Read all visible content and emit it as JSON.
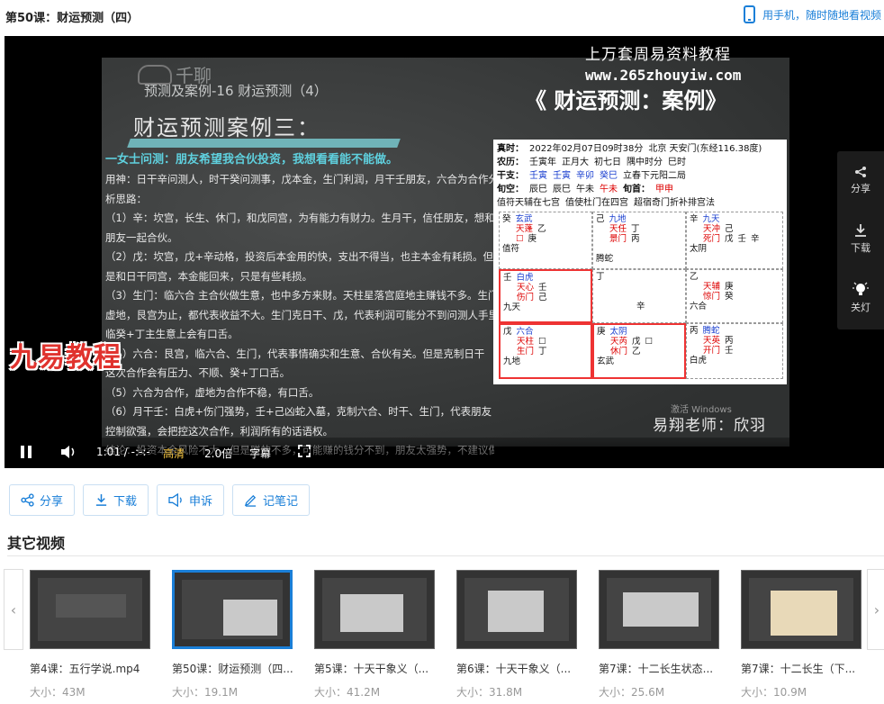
{
  "header": {
    "lesson_title": "第50课：财运预测（四）",
    "mobile_link": "用手机，随时随地看视频"
  },
  "video": {
    "watermark_line1": "上万套周易资料教程",
    "watermark_line2": "www.265zhouyiw.com",
    "logo_text": "千聊",
    "slide_subtitle": "预测及案例-16  财运预测（4）",
    "slide_heading": "财运预测案例三：",
    "slide_big_title": "《 财运预测：案例》",
    "slide_question": "一女士问测：朋友希望我合伙投资，我想看看能不能做。",
    "slide_lines": [
      "用神：日干辛问测人，时干癸问测事，戊本金，生门利润，月干壬朋友，六合为合作分",
      "析思路：",
      "（1）辛：坎宫，长生、休门，和戊同宫，为有能力有财力。生月干，信任朋友，想和",
      "朋友一起合伙。",
      "（2）戊：坎宫，戊+辛动格，投资后本金用的快，支出不得当，也主本金有耗损。但",
      "是和日干同宫，本金能回来，只是有些耗损。",
      "（3）生门：临六合 主合伙做生意，也中多方来财。天柱星落宫庭地主赚钱不多。生门",
      "虚地，艮宫为止，都代表收益不大。生门克日干、戊，代表利润可能分不到问测人手里",
      "临癸+丁主生意上会有口舌。",
      "（4）六合：艮宫，临六合、生门，代表事情确实和生意、合伙有关。但是克制日干",
      "这次合作会有压力、不顺、癸+丁口舌。",
      "（5）六合为合作，虚地为合作不稳，有口舌。",
      "（6）月干壬：白虎+伤门强势，壬+己凶蛇入墓，克制六合、时干、生门，代表朋友",
      "控制欲强，会把控这次合作，利润所有的话语权。",
      "结论：投资本金风险不大，但是赚的不多，可能赚的钱分不到，朋友太强势，不建议做"
    ],
    "brand_badge": "九易教程",
    "teacher": "易翔老师：欣羽",
    "windows_watermark": "激活 Windows",
    "chart": {
      "head_rows": [
        [
          {
            "t": "真时：",
            "b": true
          },
          {
            "t": "2022年02月07日09时38分"
          },
          {
            "t": "北京 天安门(东经116.38度)"
          }
        ],
        [
          {
            "t": "农历：",
            "b": true
          },
          {
            "t": "壬寅年"
          },
          {
            "t": "正月大"
          },
          {
            "t": "初七日"
          },
          {
            "t": "隅中时分"
          },
          {
            "t": "巳时"
          }
        ],
        [
          {
            "t": "干支：",
            "b": true
          },
          {
            "t": "壬寅",
            "c": "blue"
          },
          {
            "t": "壬寅",
            "c": "blue"
          },
          {
            "t": "辛卯",
            "c": "blue"
          },
          {
            "t": "癸巳",
            "c": "blue"
          },
          {
            "t": "立春下元阳二局"
          }
        ],
        [
          {
            "t": "旬空：",
            "b": true
          },
          {
            "t": "辰巳"
          },
          {
            "t": "辰巳"
          },
          {
            "t": "午未"
          },
          {
            "t": "午未",
            "c": "red"
          },
          {
            "t": "旬首：",
            "b": true
          },
          {
            "t": "甲申",
            "c": "red"
          }
        ],
        [
          {
            "t": "值符天辅在七宫"
          },
          {
            "t": "值使杜门在四宫"
          },
          {
            "t": "超宿奇门折补排宫法"
          }
        ]
      ],
      "cells": [
        {
          "lines": [
            [
              "癸",
              "玄武"
            ],
            [
              "",
              "天蓬",
              "乙"
            ],
            [
              "",
              "☐",
              "庚"
            ],
            [
              "值符"
            ]
          ],
          "box": false
        },
        {
          "lines": [
            [
              "己",
              "九地"
            ],
            [
              "",
              "天任",
              "丁"
            ],
            [
              "",
              "景门",
              "丙"
            ],
            [
              ""
            ],
            [
              "腾蛇"
            ]
          ],
          "box": false
        },
        {
          "lines": [
            [
              "辛",
              "九天"
            ],
            [
              "",
              "天冲",
              "己"
            ],
            [
              "",
              "死门",
              "戊",
              "壬",
              "辛"
            ],
            [
              "太阴"
            ]
          ],
          "box": false
        },
        {
          "lines": [
            [
              "壬",
              "白虎"
            ],
            [
              "",
              "天心",
              "壬"
            ],
            [
              "",
              "伤门",
              "己"
            ],
            [
              "九天"
            ]
          ],
          "box": true
        },
        {
          "lines": [
            [
              "丁"
            ],
            [
              ""
            ],
            [
              ""
            ],
            [
              "",
              "",
              "",
              "辛"
            ]
          ],
          "box": false
        },
        {
          "lines": [
            [
              "乙"
            ],
            [
              "",
              "天辅",
              "庚"
            ],
            [
              "",
              "惊门",
              "癸"
            ],
            [
              "六合"
            ]
          ],
          "box": false
        },
        {
          "lines": [
            [
              "戊",
              "六合"
            ],
            [
              "",
              "天柱",
              "☐"
            ],
            [
              "",
              "生门",
              "丁"
            ],
            [
              "九地"
            ]
          ],
          "box": true
        },
        {
          "lines": [
            [
              "庚",
              "太阴"
            ],
            [
              "",
              "天芮",
              "戊",
              "☐"
            ],
            [
              "",
              "休门",
              "乙"
            ],
            [
              "玄武"
            ]
          ],
          "box": true
        },
        {
          "lines": [
            [
              "丙",
              "腾蛇"
            ],
            [
              "",
              "天英",
              "丙"
            ],
            [
              "",
              "开门",
              "壬"
            ],
            [
              "白虎"
            ]
          ],
          "box": false
        }
      ]
    },
    "controls": {
      "time": "1:01 / -:-:-",
      "quality": "高清",
      "speed": "2.0倍",
      "subtitle": "字幕"
    },
    "side_panel": {
      "share": "分享",
      "download": "下载",
      "lights_off": "关灯"
    }
  },
  "actions": [
    {
      "label": "分享",
      "icon": "share-icon"
    },
    {
      "label": "下载",
      "icon": "download-icon"
    },
    {
      "label": "申诉",
      "icon": "megaphone-icon"
    },
    {
      "label": "记笔记",
      "icon": "pencil-icon"
    }
  ],
  "other_videos": {
    "section_title": "其它视频",
    "items": [
      {
        "title": "第4课：五行学说.mp4",
        "size": "大小：43M"
      },
      {
        "title": "第50课：财运预测（四...",
        "size": "大小：19.1M",
        "active": true
      },
      {
        "title": "第5课：十天干象义（...",
        "size": "大小：41.2M"
      },
      {
        "title": "第6课：十天干象义（...",
        "size": "大小：31.8M"
      },
      {
        "title": "第7课：十二长生状态...",
        "size": "大小：25.6M"
      },
      {
        "title": "第7课：十二长生（下...",
        "size": "大小：10.9M"
      }
    ]
  },
  "colors": {
    "accent": "#1a7fd8",
    "quality_text": "#f5c542",
    "slide_cyan": "#5fd0de",
    "brand_red": "#e0332e"
  }
}
